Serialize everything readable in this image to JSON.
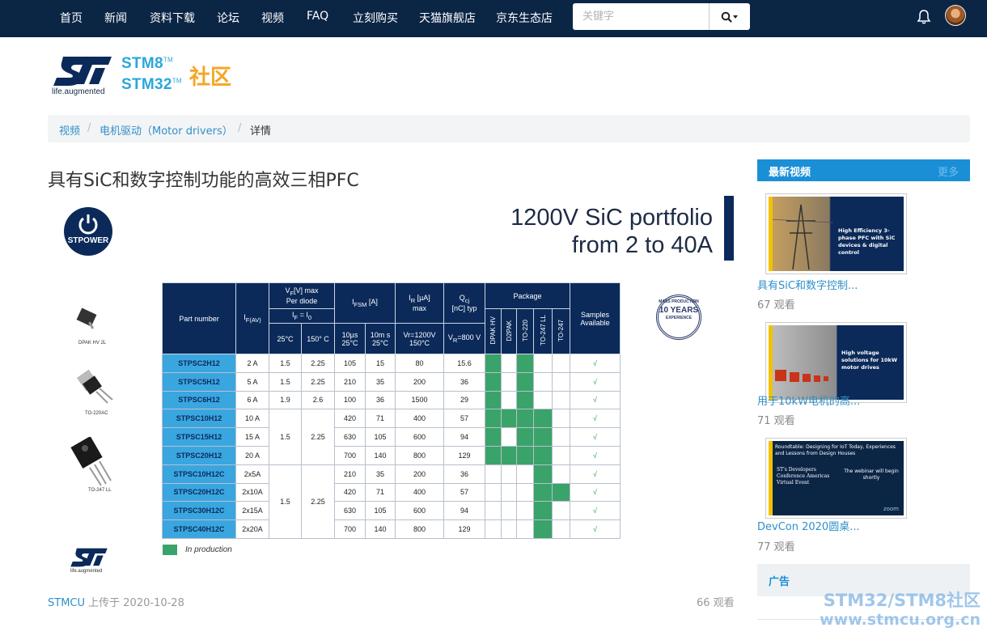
{
  "nav": {
    "items": [
      "首页",
      "新闻",
      "资料下载",
      "论坛",
      "视频",
      "FAQ",
      "立刻购买",
      "天猫旗舰店",
      "京东生态店"
    ],
    "search_placeholder": "关键字"
  },
  "logo": {
    "tagline": "life.augmented",
    "line1": "STM8",
    "line2": "STM32",
    "tm": "TM",
    "community": "社区"
  },
  "breadcrumb": {
    "items": [
      "视频",
      "电机驱动（Motor drivers）",
      "详情"
    ],
    "separator": "/"
  },
  "page_title": "具有SiC和数字控制功能的高效三相PFC",
  "slide": {
    "title_line1": "1200V SiC portfolio",
    "title_line2": "from 2 to 40A",
    "stpower": "STPOWER",
    "badge": "10 YEARS",
    "badge_top": "MASS PRODUCTION",
    "badge_bottom": "EXPERIENCE",
    "pkg_labels": [
      "DPAK HV 2L",
      "TO-220AC",
      "TO-247 LL"
    ],
    "st_tagline": "life.augmented",
    "table": {
      "h_part": "Part number",
      "h_if": "I",
      "h_if_sub": "F(AV)",
      "h_vf": "V",
      "h_vf_sub": "F",
      "h_vf_rest": "[V] max",
      "h_vf_line2": "Per diode",
      "h_vf_cond": "I",
      "h_vf_cond_sub1": "F",
      "h_vf_cond_eq": " = I",
      "h_vf_cond_sub2": "0",
      "h_ifsm": "I",
      "h_ifsm_sub": "FSM",
      "h_ifsm_rest": " [A]",
      "h_ir": "I",
      "h_ir_sub": "R",
      "h_ir_rest": " [µA]",
      "h_ir_line2": "max",
      "h_qc": "Q",
      "h_qc_sub": "cj",
      "h_qc_line2": "[nC] typ",
      "h_package": "Package",
      "h_samples": "Samples Available",
      "sub_25": "25°C",
      "sub_150": "150° C",
      "sub_10us": "10µs 25°C",
      "sub_10ms": "10m s 25°C",
      "sub_vr": "Vr=1200V 150°C",
      "sub_qc": "V",
      "sub_qc_sub": "R",
      "sub_qc_rest": "=800 V",
      "pkg_cols": [
        "DPAK HV",
        "D2PAK",
        "TO-220",
        "TO-247 LL",
        "TO-247"
      ],
      "rows": [
        {
          "pn": "STPSC2H12",
          "if": "2 A",
          "vf25": "1.5",
          "vf150": "2.25",
          "ifsm1": "105",
          "ifsm2": "15",
          "ir": "80",
          "qc": "15.6",
          "pkg": [
            1,
            0,
            1,
            0,
            0
          ],
          "chk": "√"
        },
        {
          "pn": "STPSC5H12",
          "if": "5 A",
          "vf25": "1.5",
          "vf150": "2.25",
          "ifsm1": "210",
          "ifsm2": "35",
          "ir": "200",
          "qc": "36",
          "pkg": [
            1,
            0,
            1,
            0,
            0
          ],
          "chk": "√"
        },
        {
          "pn": "STPSC6H12",
          "if": "6 A",
          "vf25": "1.9",
          "vf150": "2.6",
          "ifsm1": "100",
          "ifsm2": "36",
          "ir": "1500",
          "qc": "29",
          "pkg": [
            1,
            0,
            1,
            0,
            0
          ],
          "chk": "√"
        },
        {
          "pn": "STPSC10H12",
          "if": "10 A",
          "ifsm1": "420",
          "ifsm2": "71",
          "ir": "400",
          "qc": "57",
          "pkg": [
            1,
            1,
            1,
            1,
            0
          ],
          "chk": "√"
        },
        {
          "pn": "STPSC15H12",
          "if": "15 A",
          "ifsm1": "630",
          "ifsm2": "105",
          "ir": "600",
          "qc": "94",
          "pkg": [
            1,
            0,
            1,
            1,
            0
          ],
          "chk": "√"
        },
        {
          "pn": "STPSC20H12",
          "if": "20 A",
          "ifsm1": "700",
          "ifsm2": "140",
          "ir": "800",
          "qc": "129",
          "pkg": [
            1,
            1,
            1,
            1,
            0
          ],
          "chk": "√"
        },
        {
          "pn": "STPSC10H12C",
          "if": "2x5A",
          "ifsm1": "210",
          "ifsm2": "35",
          "ir": "200",
          "qc": "36",
          "pkg": [
            0,
            0,
            0,
            1,
            0
          ],
          "chk": "√"
        },
        {
          "pn": "STPSC20H12C",
          "if": "2x10A",
          "ifsm1": "420",
          "ifsm2": "71",
          "ir": "400",
          "qc": "57",
          "pkg": [
            0,
            0,
            0,
            1,
            1
          ],
          "chk": "√"
        },
        {
          "pn": "STPSC30H12C",
          "if": "2x15A",
          "ifsm1": "630",
          "ifsm2": "105",
          "ir": "600",
          "qc": "94",
          "pkg": [
            0,
            0,
            0,
            1,
            0
          ],
          "chk": "√"
        },
        {
          "pn": "STPSC40H12C",
          "if": "2x20A",
          "ifsm1": "700",
          "ifsm2": "140",
          "ir": "800",
          "qc": "129",
          "pkg": [
            0,
            0,
            0,
            1,
            0
          ],
          "chk": "√"
        }
      ],
      "merged_vf25_a": "1.5",
      "merged_vf150_a": "2.25",
      "merged_vf25_b": "1.5",
      "merged_vf150_b": "2.25"
    },
    "legend": "In production"
  },
  "meta": {
    "uploader": "STMCU",
    "uploaded_text": "上传于 2020-10-28",
    "views": "66 观看"
  },
  "sidebar": {
    "header": "最新视频",
    "more": "更多",
    "videos": [
      {
        "title": "具有SiC和数字控制...",
        "views": "67 观看",
        "thumb_text": "High Efficiency 3-phase PFC with SiC devices & digital control"
      },
      {
        "title": "用于10kW电机的高...",
        "views": "71 观看",
        "thumb_text": "High voltage solutions for 10kW motor drives"
      },
      {
        "title": "DevCon 2020圆桌...",
        "views": "77 观看",
        "thumb_text": "Roundtable: Designing for IoT Today, Experiences and Lessons from Design Houses",
        "thumb_sub": "The webinar will begin shortly",
        "thumb_brand": "ST's Developers Conference Americas Virtual Event",
        "thumb_zoom": "zoom"
      }
    ],
    "ad_title": "广告"
  },
  "watermark": {
    "line1": "STM32/STM8社区",
    "line2": "www.stmcu.org.cn"
  },
  "colors": {
    "nav_bg": "#0b2545",
    "accent": "#1a8fd6",
    "link": "#2f90c8",
    "logo_blue": "#2aa7dc",
    "logo_orange": "#f5a623",
    "production_green": "#3aa36a"
  }
}
